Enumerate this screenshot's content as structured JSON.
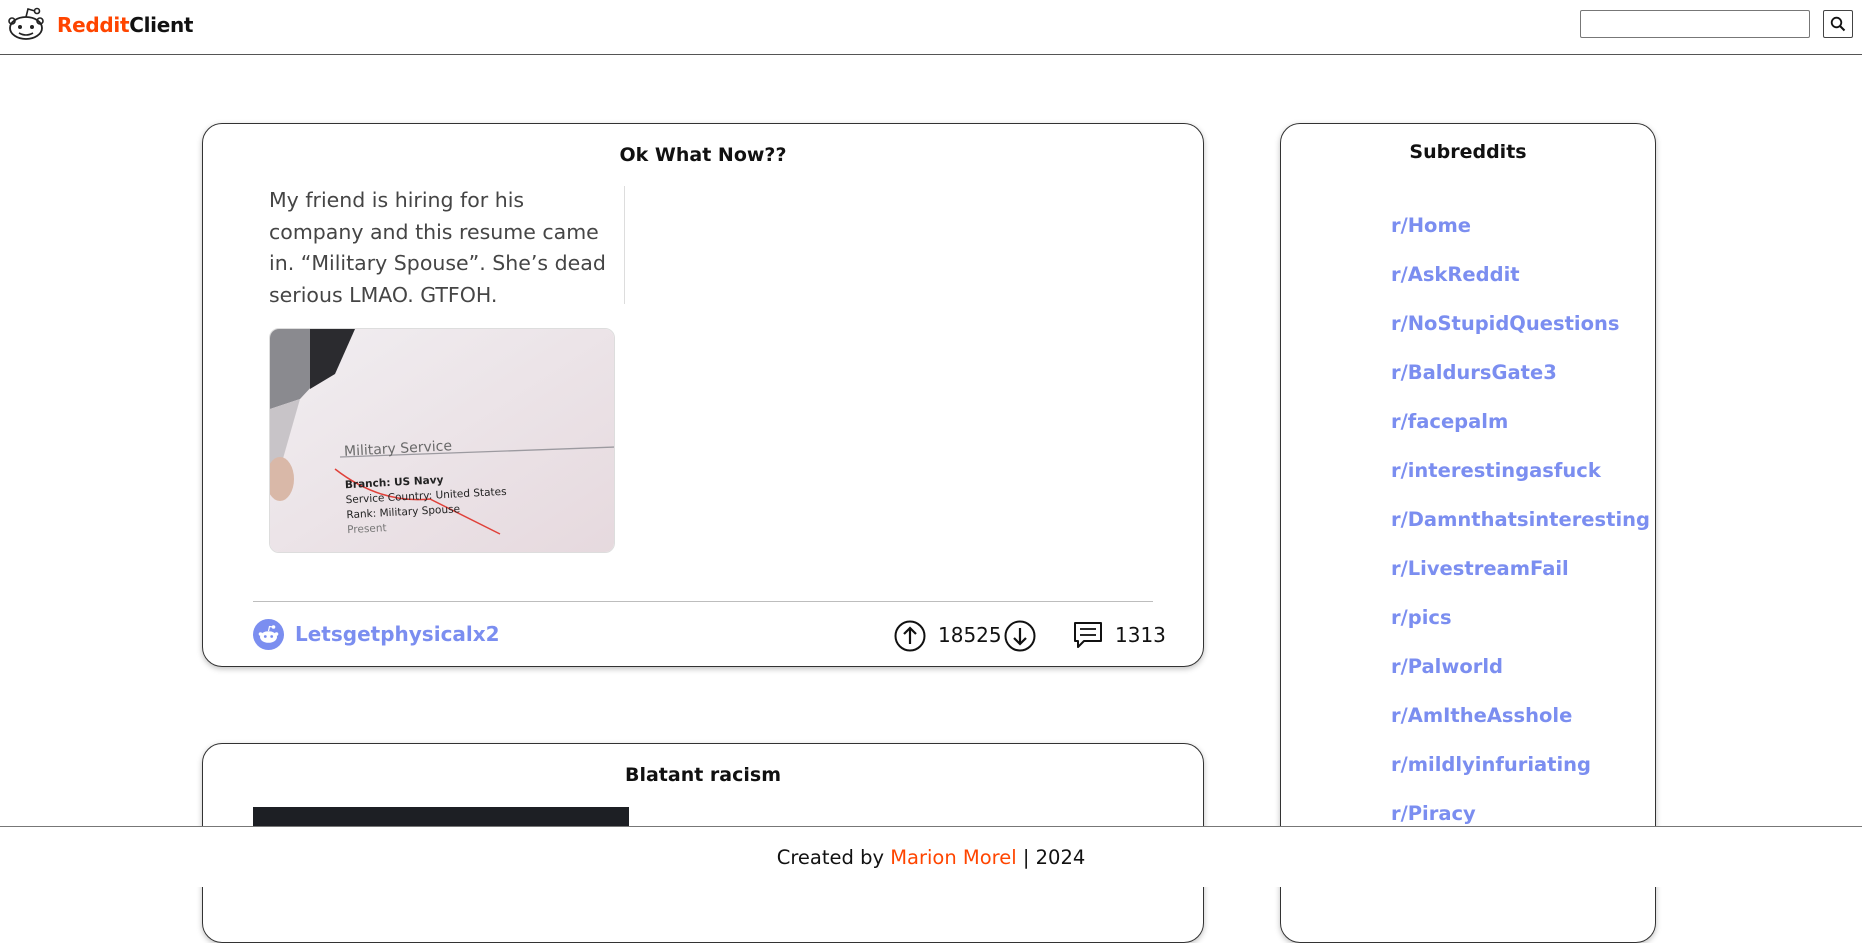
{
  "header": {
    "brand_accent": "Reddit",
    "brand_rest": "Client",
    "logo_icon": "reddit-alien-icon",
    "search": {
      "value": "",
      "placeholder": ""
    },
    "search_button_icon": "search-icon"
  },
  "colors": {
    "accent": "#ff4500",
    "link": "#7b8ef0",
    "border": "#333333"
  },
  "posts": [
    {
      "title": "Ok What Now??",
      "embed_text": "My friend is hiring for his company and this resume came in. “Military Spouse”. She’s dead serious LMAO. GTFOH.",
      "image": {
        "heading": "Military Service",
        "lines": [
          "Branch: US Navy",
          "Service Country: United States",
          "Rank: Military Spouse",
          "Present"
        ]
      },
      "author": "Letsgetphysicalx2",
      "score": "18525",
      "comments": "1313"
    },
    {
      "title": "Blatant racism"
    }
  ],
  "sidebar": {
    "title": "Subreddits",
    "items": [
      "r/Home",
      "r/AskReddit",
      "r/NoStupidQuestions",
      "r/BaldursGate3",
      "r/facepalm",
      "r/interestingasfuck",
      "r/Damnthatsinteresting",
      "r/LivestreamFail",
      "r/pics",
      "r/Palworld",
      "r/AmItheAsshole",
      "r/mildlyinfuriating",
      "r/Piracy"
    ]
  },
  "footer": {
    "prefix": "Created by",
    "author": "Marion Morel",
    "suffix": "| 2024"
  }
}
